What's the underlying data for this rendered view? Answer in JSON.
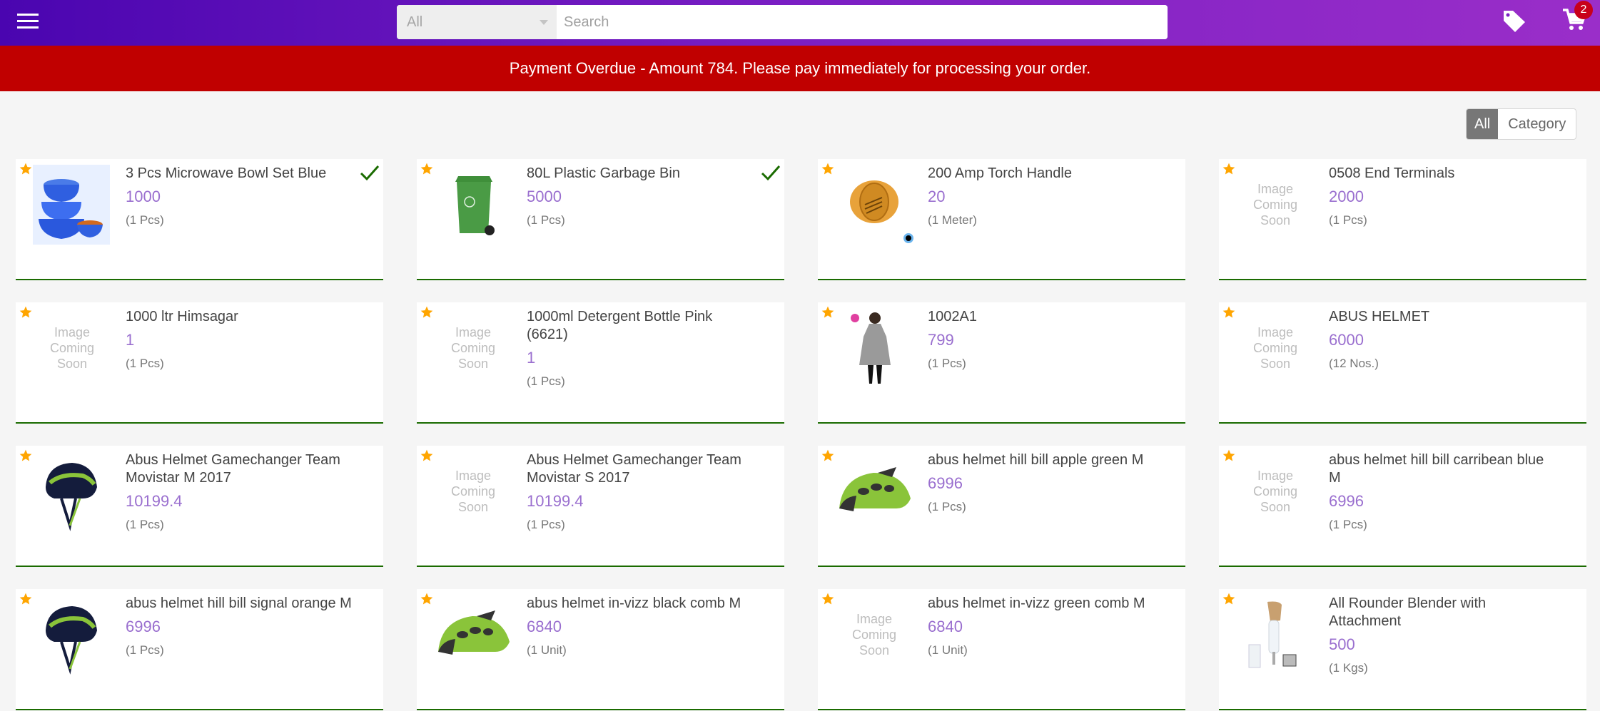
{
  "header": {
    "search_category": "All",
    "search_placeholder": "Search",
    "cart_count": "2"
  },
  "alert": {
    "message": "Payment Overdue - Amount 784. Please pay immediately for processing your order."
  },
  "view_toggle": {
    "options": [
      "All",
      "Category"
    ],
    "selected": "All"
  },
  "products": [
    {
      "name": "3 Pcs Microwave Bowl Set Blue",
      "price": "1000",
      "unit": "(1 Pcs)",
      "image": "bowl-set",
      "selected": true
    },
    {
      "name": "80L Plastic Garbage Bin",
      "price": "5000",
      "unit": "(1 Pcs)",
      "image": "garbage-bin",
      "selected": true
    },
    {
      "name": "200 Amp Torch Handle",
      "price": "20",
      "unit": "(1 Meter)",
      "image": "ring",
      "selected": false
    },
    {
      "name": "0508 End Terminals",
      "price": "2000",
      "unit": "(1 Pcs)",
      "image": "placeholder",
      "selected": false
    },
    {
      "name": "1000 ltr Himsagar",
      "price": "1",
      "unit": "(1 Pcs)",
      "image": "placeholder",
      "selected": false
    },
    {
      "name": "1000ml Detergent Bottle Pink (6621)",
      "price": "1",
      "unit": "(1 Pcs)",
      "image": "placeholder",
      "selected": false
    },
    {
      "name": "1002A1",
      "price": "799",
      "unit": "(1 Pcs)",
      "image": "kurti",
      "selected": false
    },
    {
      "name": "ABUS HELMET",
      "price": "6000",
      "unit": "(12 Nos.)",
      "image": "placeholder",
      "selected": false
    },
    {
      "name": "Abus Helmet Gamechanger Team Movistar M 2017",
      "price": "10199.4",
      "unit": "(1 Pcs)",
      "image": "helmet-dark",
      "selected": false
    },
    {
      "name": "Abus Helmet Gamechanger Team Movistar S 2017",
      "price": "10199.4",
      "unit": "(1 Pcs)",
      "image": "placeholder",
      "selected": false
    },
    {
      "name": "abus helmet hill bill apple green M",
      "price": "6996",
      "unit": "(1 Pcs)",
      "image": "helmet-green",
      "selected": false
    },
    {
      "name": "abus helmet hill bill carribean blue M",
      "price": "6996",
      "unit": "(1 Pcs)",
      "image": "placeholder",
      "selected": false
    },
    {
      "name": "abus helmet hill bill signal orange M",
      "price": "6996",
      "unit": "(1 Pcs)",
      "image": "helmet-dark",
      "selected": false
    },
    {
      "name": "abus helmet in-vizz black comb M",
      "price": "6840",
      "unit": "(1 Unit)",
      "image": "helmet-green",
      "selected": false
    },
    {
      "name": "abus helmet in-vizz green comb M",
      "price": "6840",
      "unit": "(1 Unit)",
      "image": "placeholder",
      "selected": false
    },
    {
      "name": "All Rounder Blender with Attachment",
      "price": "500",
      "unit": "(1 Kgs)",
      "image": "blender",
      "selected": false
    }
  ],
  "placeholder_text": [
    "Image",
    "Coming",
    "Soon"
  ],
  "colors": {
    "header_gradient_start": "#4a05b0",
    "header_gradient_end": "#9a2ec9",
    "alert_bg": "#c00000",
    "price": "#9a6fcf",
    "card_border": "#1a6b00",
    "star": "#ffa500",
    "check": "#1a6b00",
    "badge": "#c8001a"
  }
}
